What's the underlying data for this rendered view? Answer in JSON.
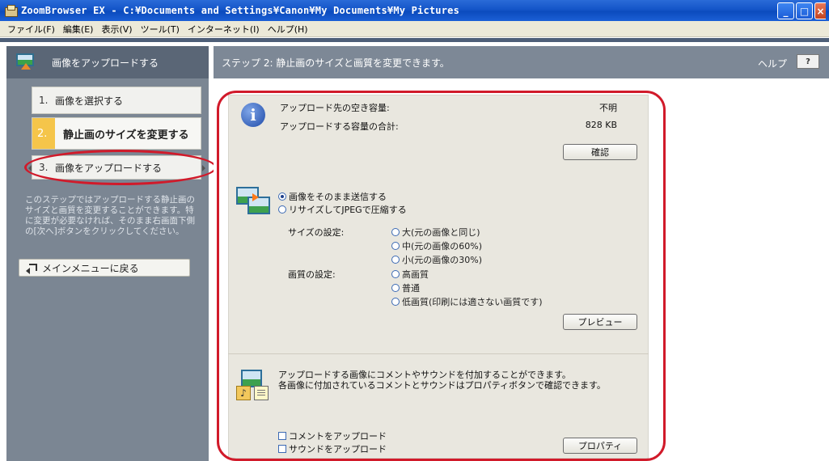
{
  "window": {
    "title": "ZoomBrowser EX  -  C:¥Documents and Settings¥Canon¥My Documents¥My Pictures",
    "buttons": {
      "minimize": "_",
      "maximize": "□",
      "close": "×"
    }
  },
  "menu": [
    "ファイル(F)",
    "編集(E)",
    "表示(V)",
    "ツール(T)",
    "インターネット(I)",
    "ヘルプ(H)"
  ],
  "left": {
    "header": "画像をアップロードする",
    "steps": [
      {
        "num": "1.",
        "label": "画像を選択する"
      },
      {
        "num": "2.",
        "label": "静止画のサイズを変更する"
      },
      {
        "num": "3.",
        "label": "画像をアップロードする"
      }
    ],
    "help_text": "このステップではアップロードする静止画のサイズと画質を変更することができます。特に変更が必要なければ、そのまま右画面下側の[次へ]ボタンをクリックしてください。",
    "back_button": "メインメニューに戻る"
  },
  "right": {
    "header": "ステップ 2: 静止画のサイズと画質を変更できます。",
    "help_label": "ヘルプ",
    "help_button": "?",
    "free_space_label": "アップロード先の空き容量:",
    "free_space_value": "不明",
    "total_label": "アップロードする容量の合計:",
    "total_value": "828 KB",
    "confirm_button": "確認",
    "send_mode": {
      "as_is": "画像をそのまま送信する",
      "resize": "リサイズしてJPEGで圧縮する",
      "selected": "as_is"
    },
    "size_label": "サイズの設定:",
    "size_options": [
      "大(元の画像と同じ)",
      "中(元の画像の60%)",
      "小(元の画像の30%)"
    ],
    "quality_label": "画質の設定:",
    "quality_options": [
      "高画質",
      "普通",
      "低画質(印刷には適さない画質です)"
    ],
    "preview_button": "プレビュー",
    "comment_info_1": "アップロードする画像にコメントやサウンドを付加することができます。",
    "comment_info_2": "各画像に付加されているコメントとサウンドはプロパティボタンで確認できます。",
    "upload_comment": "コメントをアップロード",
    "upload_sound": "サウンドをアップロード",
    "properties_button": "プロパティ"
  },
  "colors": {
    "titlebar": "#1455c8",
    "left_panel": "#7b8693",
    "highlight_oval": "#d11a2a",
    "step_active": "#f5c54a"
  }
}
